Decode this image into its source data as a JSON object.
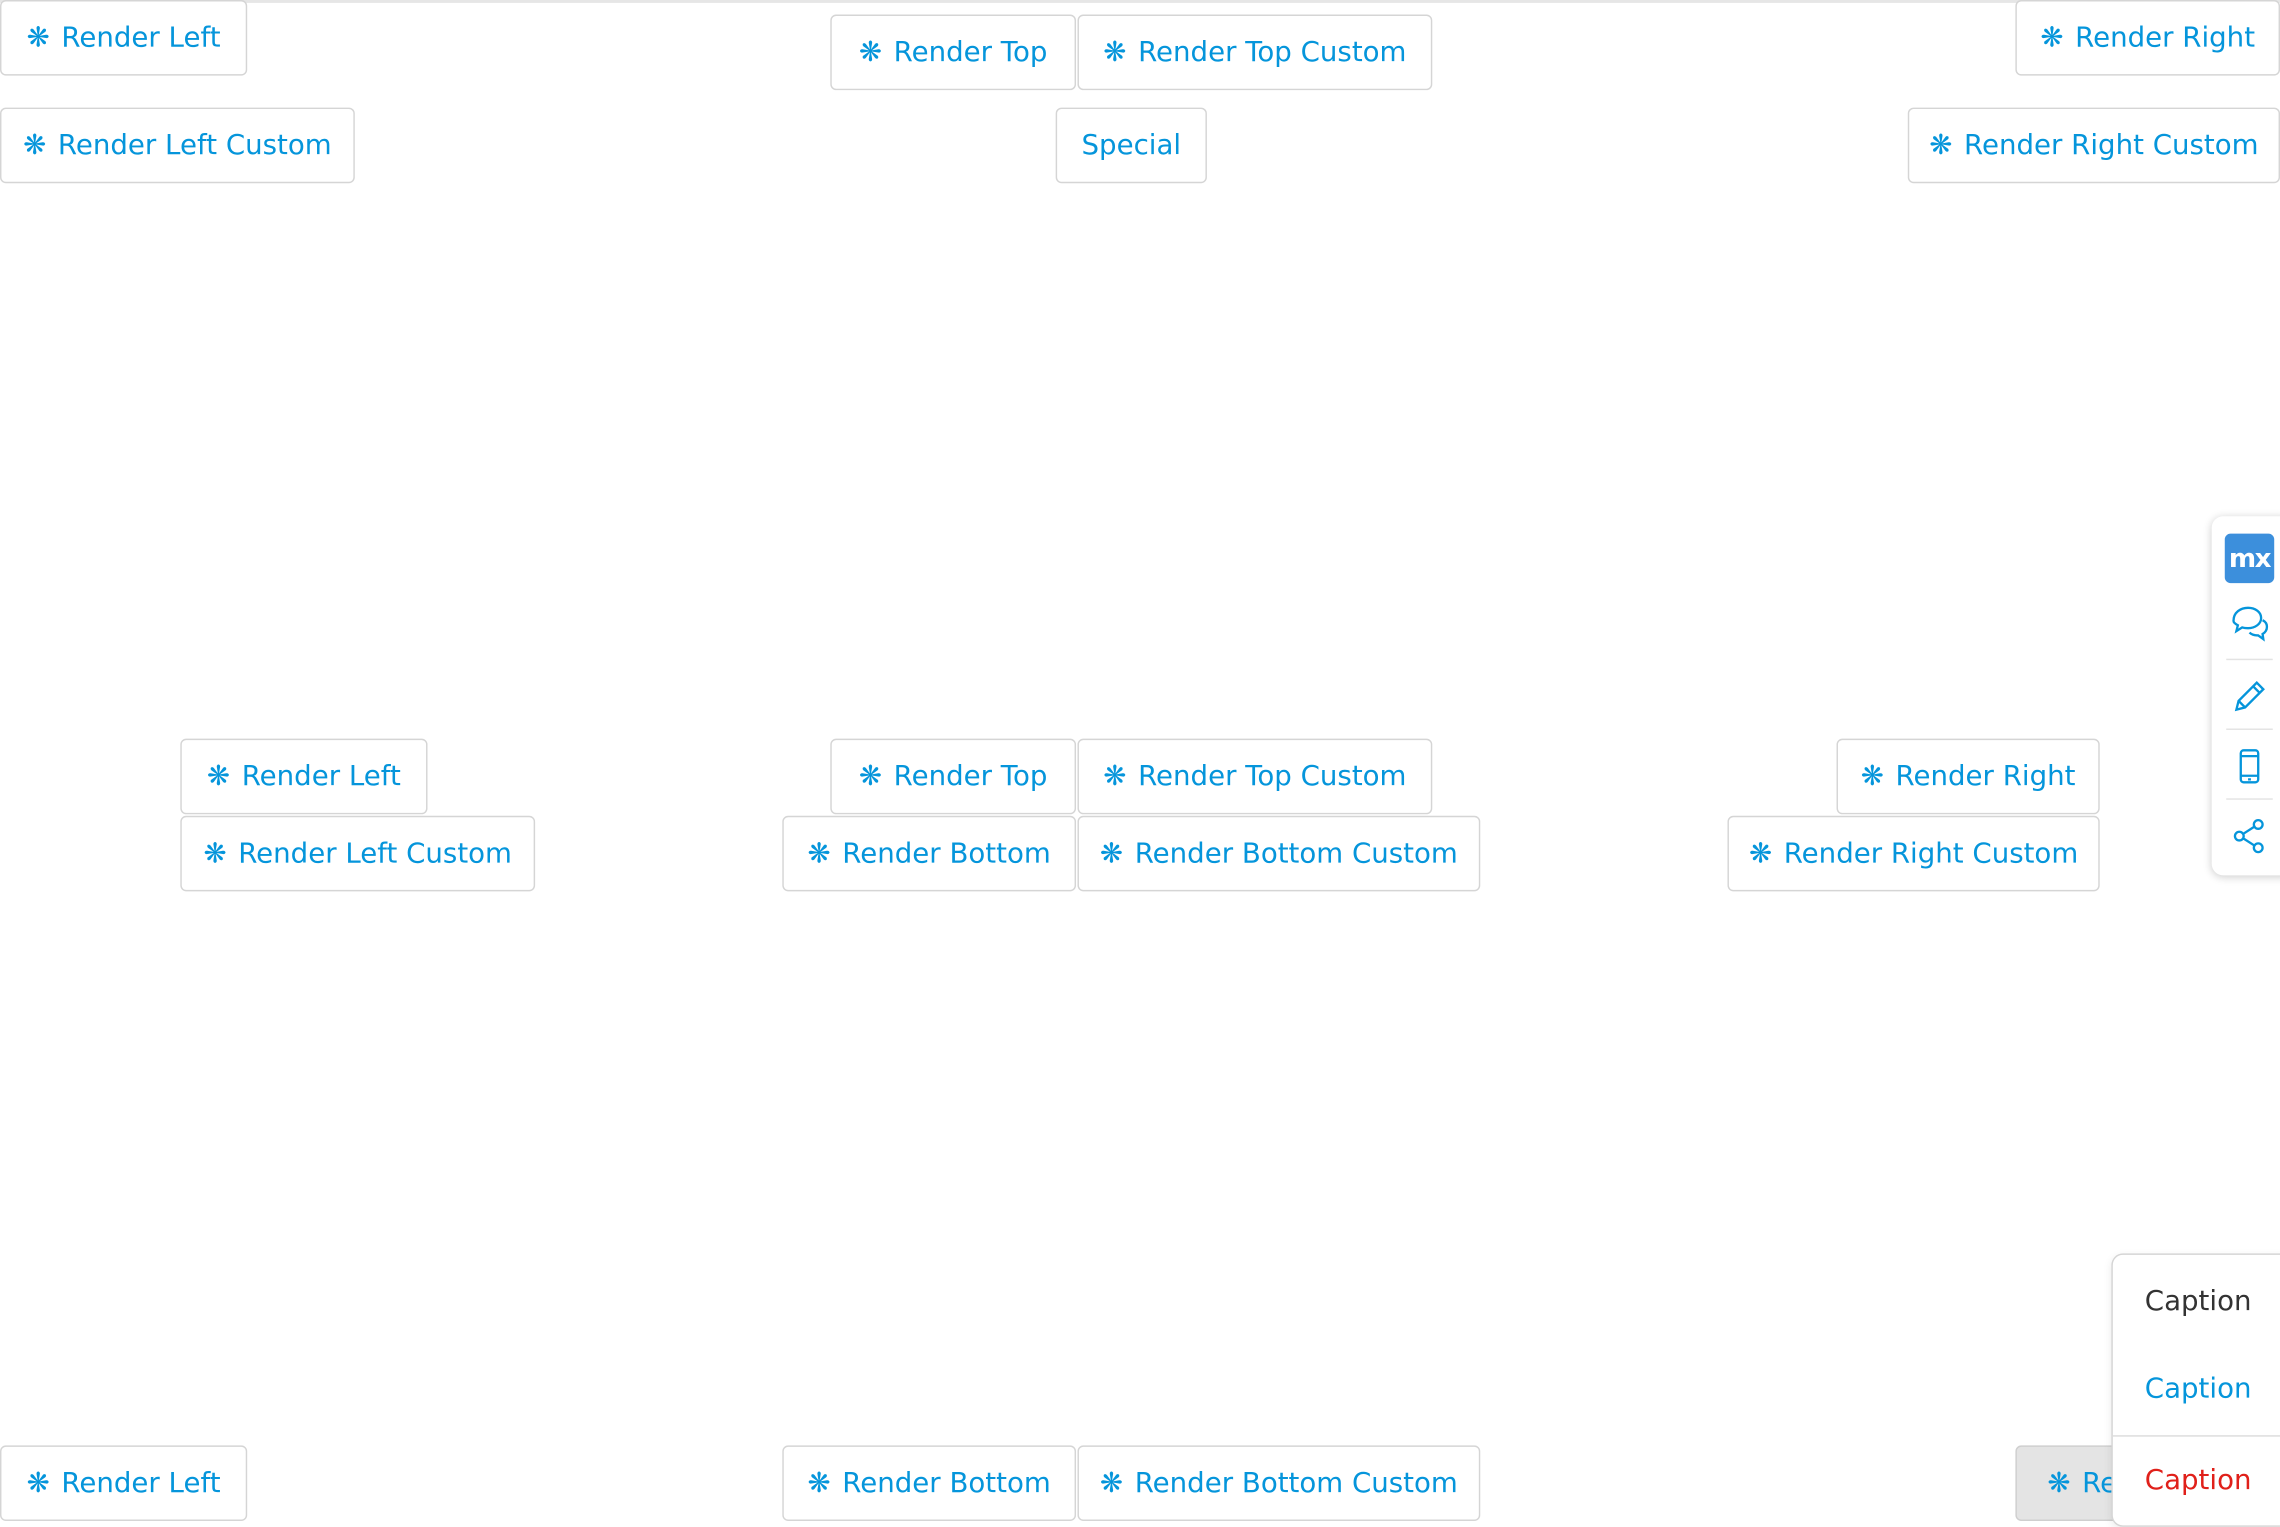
{
  "colors": {
    "accent": "#0595db",
    "danger": "#e0201a",
    "text": "#333333",
    "logo": "#3c8fdc"
  },
  "buttons": {
    "top_left_1": {
      "label": "Render Left",
      "icon": "asterisk-icon"
    },
    "top_left_2": {
      "label": "Render Left Custom",
      "icon": "asterisk-icon"
    },
    "top_center_1": {
      "label": "Render Top",
      "icon": "asterisk-icon"
    },
    "top_center_2": {
      "label": "Render Top Custom",
      "icon": "asterisk-icon"
    },
    "top_center_special": {
      "label": "Special"
    },
    "top_right_1": {
      "label": "Render Right",
      "icon": "asterisk-icon"
    },
    "top_right_2": {
      "label": "Render Right Custom",
      "icon": "asterisk-icon"
    },
    "mid_left_1": {
      "label": "Render Left",
      "icon": "asterisk-icon"
    },
    "mid_left_2": {
      "label": "Render Left Custom",
      "icon": "asterisk-icon"
    },
    "mid_center_1": {
      "label": "Render Top",
      "icon": "asterisk-icon"
    },
    "mid_center_2": {
      "label": "Render Top Custom",
      "icon": "asterisk-icon"
    },
    "mid_center_3": {
      "label": "Render Bottom",
      "icon": "asterisk-icon"
    },
    "mid_center_4": {
      "label": "Render Bottom Custom",
      "icon": "asterisk-icon"
    },
    "mid_right_1": {
      "label": "Render Right",
      "icon": "asterisk-icon"
    },
    "mid_right_2": {
      "label": "Render Right Custom",
      "icon": "asterisk-icon"
    },
    "bottom_left_1": {
      "label": "Render Left",
      "icon": "asterisk-icon"
    },
    "bottom_center_1": {
      "label": "Render Bottom",
      "icon": "asterisk-icon"
    },
    "bottom_center_2": {
      "label": "Render Bottom Custom",
      "icon": "asterisk-icon"
    },
    "bottom_right_1": {
      "label": "Re",
      "icon": "asterisk-icon"
    }
  },
  "asterisk_glyph": "❋",
  "toolbar": {
    "logo_text": "mx",
    "items": [
      "chat-icon",
      "pencil-icon",
      "mobile-icon",
      "share-icon"
    ]
  },
  "menu": {
    "items": [
      {
        "label": "Caption",
        "style": "default"
      },
      {
        "label": "Caption",
        "style": "primary"
      },
      {
        "label": "Caption",
        "style": "danger"
      }
    ]
  }
}
